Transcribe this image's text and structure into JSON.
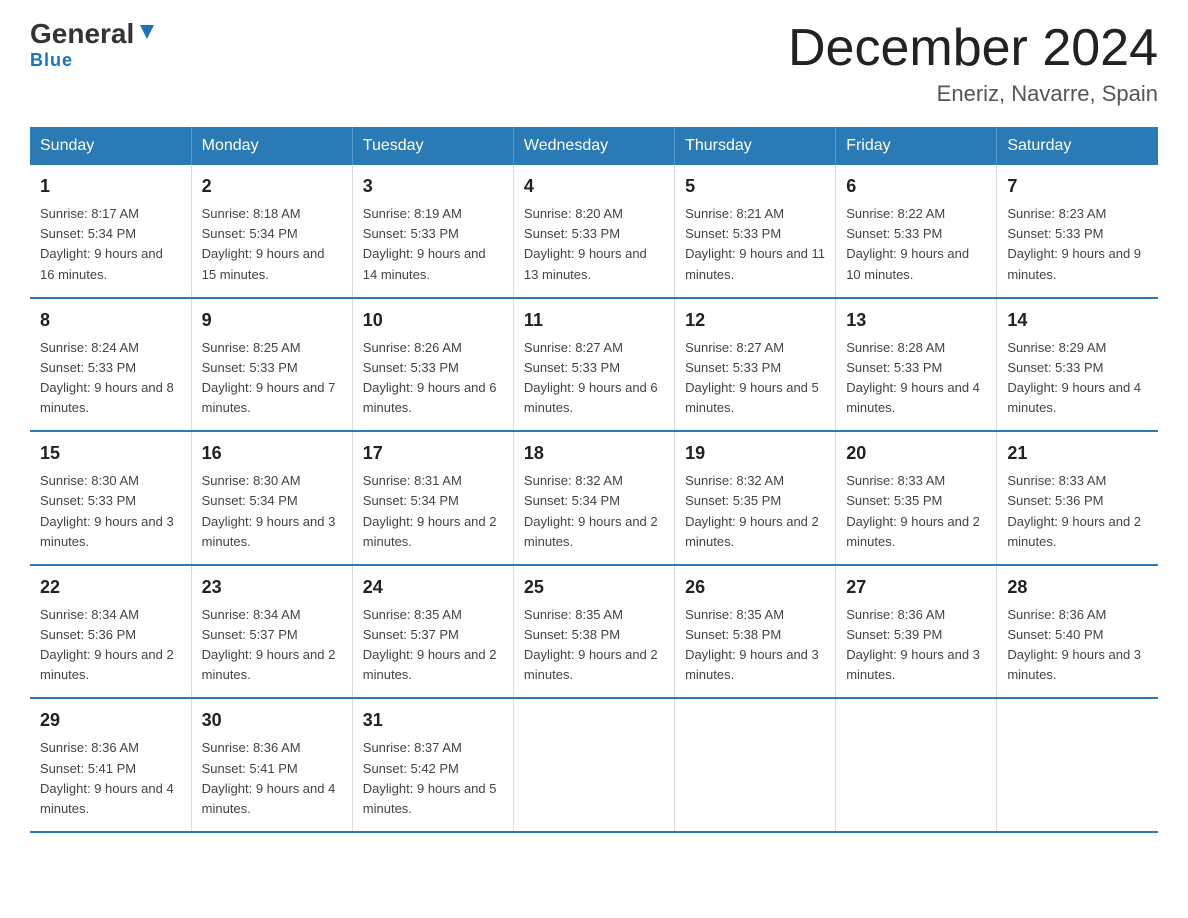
{
  "logo": {
    "general": "General",
    "blue": "Blue",
    "triangle": "▼"
  },
  "title": "December 2024",
  "subtitle": "Eneriz, Navarre, Spain",
  "headers": [
    "Sunday",
    "Monday",
    "Tuesday",
    "Wednesday",
    "Thursday",
    "Friday",
    "Saturday"
  ],
  "weeks": [
    [
      {
        "day": "1",
        "sunrise": "Sunrise: 8:17 AM",
        "sunset": "Sunset: 5:34 PM",
        "daylight": "Daylight: 9 hours and 16 minutes."
      },
      {
        "day": "2",
        "sunrise": "Sunrise: 8:18 AM",
        "sunset": "Sunset: 5:34 PM",
        "daylight": "Daylight: 9 hours and 15 minutes."
      },
      {
        "day": "3",
        "sunrise": "Sunrise: 8:19 AM",
        "sunset": "Sunset: 5:33 PM",
        "daylight": "Daylight: 9 hours and 14 minutes."
      },
      {
        "day": "4",
        "sunrise": "Sunrise: 8:20 AM",
        "sunset": "Sunset: 5:33 PM",
        "daylight": "Daylight: 9 hours and 13 minutes."
      },
      {
        "day": "5",
        "sunrise": "Sunrise: 8:21 AM",
        "sunset": "Sunset: 5:33 PM",
        "daylight": "Daylight: 9 hours and 11 minutes."
      },
      {
        "day": "6",
        "sunrise": "Sunrise: 8:22 AM",
        "sunset": "Sunset: 5:33 PM",
        "daylight": "Daylight: 9 hours and 10 minutes."
      },
      {
        "day": "7",
        "sunrise": "Sunrise: 8:23 AM",
        "sunset": "Sunset: 5:33 PM",
        "daylight": "Daylight: 9 hours and 9 minutes."
      }
    ],
    [
      {
        "day": "8",
        "sunrise": "Sunrise: 8:24 AM",
        "sunset": "Sunset: 5:33 PM",
        "daylight": "Daylight: 9 hours and 8 minutes."
      },
      {
        "day": "9",
        "sunrise": "Sunrise: 8:25 AM",
        "sunset": "Sunset: 5:33 PM",
        "daylight": "Daylight: 9 hours and 7 minutes."
      },
      {
        "day": "10",
        "sunrise": "Sunrise: 8:26 AM",
        "sunset": "Sunset: 5:33 PM",
        "daylight": "Daylight: 9 hours and 6 minutes."
      },
      {
        "day": "11",
        "sunrise": "Sunrise: 8:27 AM",
        "sunset": "Sunset: 5:33 PM",
        "daylight": "Daylight: 9 hours and 6 minutes."
      },
      {
        "day": "12",
        "sunrise": "Sunrise: 8:27 AM",
        "sunset": "Sunset: 5:33 PM",
        "daylight": "Daylight: 9 hours and 5 minutes."
      },
      {
        "day": "13",
        "sunrise": "Sunrise: 8:28 AM",
        "sunset": "Sunset: 5:33 PM",
        "daylight": "Daylight: 9 hours and 4 minutes."
      },
      {
        "day": "14",
        "sunrise": "Sunrise: 8:29 AM",
        "sunset": "Sunset: 5:33 PM",
        "daylight": "Daylight: 9 hours and 4 minutes."
      }
    ],
    [
      {
        "day": "15",
        "sunrise": "Sunrise: 8:30 AM",
        "sunset": "Sunset: 5:33 PM",
        "daylight": "Daylight: 9 hours and 3 minutes."
      },
      {
        "day": "16",
        "sunrise": "Sunrise: 8:30 AM",
        "sunset": "Sunset: 5:34 PM",
        "daylight": "Daylight: 9 hours and 3 minutes."
      },
      {
        "day": "17",
        "sunrise": "Sunrise: 8:31 AM",
        "sunset": "Sunset: 5:34 PM",
        "daylight": "Daylight: 9 hours and 2 minutes."
      },
      {
        "day": "18",
        "sunrise": "Sunrise: 8:32 AM",
        "sunset": "Sunset: 5:34 PM",
        "daylight": "Daylight: 9 hours and 2 minutes."
      },
      {
        "day": "19",
        "sunrise": "Sunrise: 8:32 AM",
        "sunset": "Sunset: 5:35 PM",
        "daylight": "Daylight: 9 hours and 2 minutes."
      },
      {
        "day": "20",
        "sunrise": "Sunrise: 8:33 AM",
        "sunset": "Sunset: 5:35 PM",
        "daylight": "Daylight: 9 hours and 2 minutes."
      },
      {
        "day": "21",
        "sunrise": "Sunrise: 8:33 AM",
        "sunset": "Sunset: 5:36 PM",
        "daylight": "Daylight: 9 hours and 2 minutes."
      }
    ],
    [
      {
        "day": "22",
        "sunrise": "Sunrise: 8:34 AM",
        "sunset": "Sunset: 5:36 PM",
        "daylight": "Daylight: 9 hours and 2 minutes."
      },
      {
        "day": "23",
        "sunrise": "Sunrise: 8:34 AM",
        "sunset": "Sunset: 5:37 PM",
        "daylight": "Daylight: 9 hours and 2 minutes."
      },
      {
        "day": "24",
        "sunrise": "Sunrise: 8:35 AM",
        "sunset": "Sunset: 5:37 PM",
        "daylight": "Daylight: 9 hours and 2 minutes."
      },
      {
        "day": "25",
        "sunrise": "Sunrise: 8:35 AM",
        "sunset": "Sunset: 5:38 PM",
        "daylight": "Daylight: 9 hours and 2 minutes."
      },
      {
        "day": "26",
        "sunrise": "Sunrise: 8:35 AM",
        "sunset": "Sunset: 5:38 PM",
        "daylight": "Daylight: 9 hours and 3 minutes."
      },
      {
        "day": "27",
        "sunrise": "Sunrise: 8:36 AM",
        "sunset": "Sunset: 5:39 PM",
        "daylight": "Daylight: 9 hours and 3 minutes."
      },
      {
        "day": "28",
        "sunrise": "Sunrise: 8:36 AM",
        "sunset": "Sunset: 5:40 PM",
        "daylight": "Daylight: 9 hours and 3 minutes."
      }
    ],
    [
      {
        "day": "29",
        "sunrise": "Sunrise: 8:36 AM",
        "sunset": "Sunset: 5:41 PM",
        "daylight": "Daylight: 9 hours and 4 minutes."
      },
      {
        "day": "30",
        "sunrise": "Sunrise: 8:36 AM",
        "sunset": "Sunset: 5:41 PM",
        "daylight": "Daylight: 9 hours and 4 minutes."
      },
      {
        "day": "31",
        "sunrise": "Sunrise: 8:37 AM",
        "sunset": "Sunset: 5:42 PM",
        "daylight": "Daylight: 9 hours and 5 minutes."
      },
      {
        "day": "",
        "sunrise": "",
        "sunset": "",
        "daylight": ""
      },
      {
        "day": "",
        "sunrise": "",
        "sunset": "",
        "daylight": ""
      },
      {
        "day": "",
        "sunrise": "",
        "sunset": "",
        "daylight": ""
      },
      {
        "day": "",
        "sunrise": "",
        "sunset": "",
        "daylight": ""
      }
    ]
  ]
}
